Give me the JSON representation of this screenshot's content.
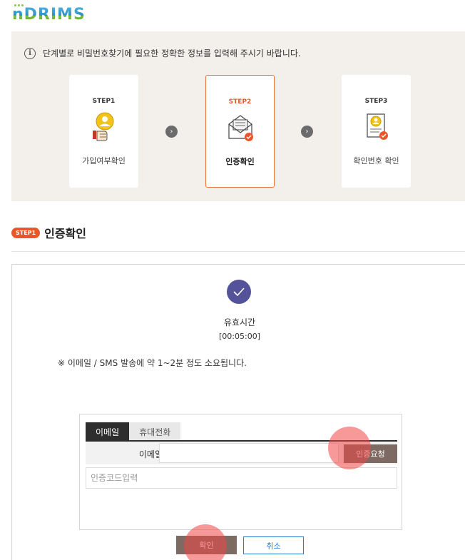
{
  "logo": {
    "text": "nDRIMS"
  },
  "info": {
    "icon": "info-circle-icon",
    "icon_glyph": "i",
    "text": "단계별로 비밀번호찾기에 필요한 정확한 정보를 입력해 주시기 바랍니다."
  },
  "steps": [
    {
      "label": "STEP1",
      "name": "가입여부확인",
      "icon": "user-thumb-icon",
      "active": false
    },
    {
      "label": "STEP2",
      "name": "인증확인",
      "icon": "envelope-check-icon",
      "active": true
    },
    {
      "label": "STEP3",
      "name": "확인번호 확인",
      "icon": "certificate-icon",
      "active": false
    }
  ],
  "step_arrow_glyph": "›",
  "section": {
    "badge": "STEP1",
    "title": "인증확인"
  },
  "verify": {
    "valid_label": "유효시간",
    "timer": "[00:05:00]",
    "notice": "※ 이메일 / SMS 발송에 약 1~2분 정도 소요됩니다."
  },
  "form": {
    "tabs": [
      {
        "label": "이메일",
        "active": true
      },
      {
        "label": "휴대전화",
        "active": false
      }
    ],
    "email_label": "이메일",
    "email_value": "",
    "request_button": "인증요청",
    "code_placeholder": "인증코드입력"
  },
  "buttons": {
    "confirm": "확인",
    "cancel": "취소"
  },
  "colors": {
    "accent": "#e8572a",
    "brown_button": "#7d6a63",
    "check": "#54539a",
    "cancel_blue": "#2e7bd6",
    "info_bg": "#f3f0ec"
  }
}
